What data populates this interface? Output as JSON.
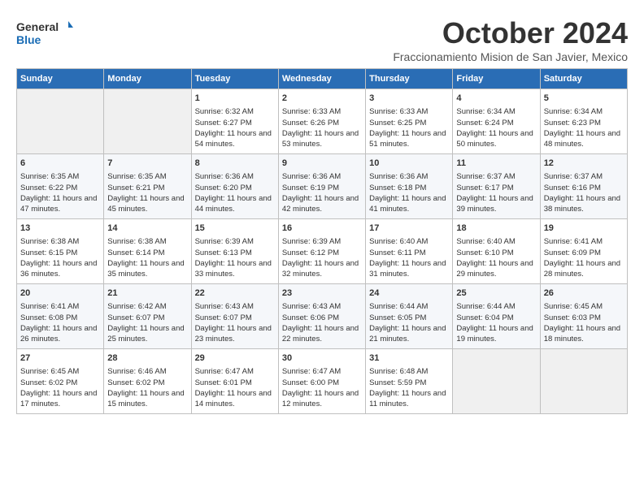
{
  "header": {
    "logo_line1": "General",
    "logo_line2": "Blue",
    "month": "October 2024",
    "location": "Fraccionamiento Mision de San Javier, Mexico"
  },
  "days_of_week": [
    "Sunday",
    "Monday",
    "Tuesday",
    "Wednesday",
    "Thursday",
    "Friday",
    "Saturday"
  ],
  "weeks": [
    [
      {
        "day": "",
        "info": ""
      },
      {
        "day": "",
        "info": ""
      },
      {
        "day": "1",
        "info": "Sunrise: 6:32 AM\nSunset: 6:27 PM\nDaylight: 11 hours and 54 minutes."
      },
      {
        "day": "2",
        "info": "Sunrise: 6:33 AM\nSunset: 6:26 PM\nDaylight: 11 hours and 53 minutes."
      },
      {
        "day": "3",
        "info": "Sunrise: 6:33 AM\nSunset: 6:25 PM\nDaylight: 11 hours and 51 minutes."
      },
      {
        "day": "4",
        "info": "Sunrise: 6:34 AM\nSunset: 6:24 PM\nDaylight: 11 hours and 50 minutes."
      },
      {
        "day": "5",
        "info": "Sunrise: 6:34 AM\nSunset: 6:23 PM\nDaylight: 11 hours and 48 minutes."
      }
    ],
    [
      {
        "day": "6",
        "info": "Sunrise: 6:35 AM\nSunset: 6:22 PM\nDaylight: 11 hours and 47 minutes."
      },
      {
        "day": "7",
        "info": "Sunrise: 6:35 AM\nSunset: 6:21 PM\nDaylight: 11 hours and 45 minutes."
      },
      {
        "day": "8",
        "info": "Sunrise: 6:36 AM\nSunset: 6:20 PM\nDaylight: 11 hours and 44 minutes."
      },
      {
        "day": "9",
        "info": "Sunrise: 6:36 AM\nSunset: 6:19 PM\nDaylight: 11 hours and 42 minutes."
      },
      {
        "day": "10",
        "info": "Sunrise: 6:36 AM\nSunset: 6:18 PM\nDaylight: 11 hours and 41 minutes."
      },
      {
        "day": "11",
        "info": "Sunrise: 6:37 AM\nSunset: 6:17 PM\nDaylight: 11 hours and 39 minutes."
      },
      {
        "day": "12",
        "info": "Sunrise: 6:37 AM\nSunset: 6:16 PM\nDaylight: 11 hours and 38 minutes."
      }
    ],
    [
      {
        "day": "13",
        "info": "Sunrise: 6:38 AM\nSunset: 6:15 PM\nDaylight: 11 hours and 36 minutes."
      },
      {
        "day": "14",
        "info": "Sunrise: 6:38 AM\nSunset: 6:14 PM\nDaylight: 11 hours and 35 minutes."
      },
      {
        "day": "15",
        "info": "Sunrise: 6:39 AM\nSunset: 6:13 PM\nDaylight: 11 hours and 33 minutes."
      },
      {
        "day": "16",
        "info": "Sunrise: 6:39 AM\nSunset: 6:12 PM\nDaylight: 11 hours and 32 minutes."
      },
      {
        "day": "17",
        "info": "Sunrise: 6:40 AM\nSunset: 6:11 PM\nDaylight: 11 hours and 31 minutes."
      },
      {
        "day": "18",
        "info": "Sunrise: 6:40 AM\nSunset: 6:10 PM\nDaylight: 11 hours and 29 minutes."
      },
      {
        "day": "19",
        "info": "Sunrise: 6:41 AM\nSunset: 6:09 PM\nDaylight: 11 hours and 28 minutes."
      }
    ],
    [
      {
        "day": "20",
        "info": "Sunrise: 6:41 AM\nSunset: 6:08 PM\nDaylight: 11 hours and 26 minutes."
      },
      {
        "day": "21",
        "info": "Sunrise: 6:42 AM\nSunset: 6:07 PM\nDaylight: 11 hours and 25 minutes."
      },
      {
        "day": "22",
        "info": "Sunrise: 6:43 AM\nSunset: 6:07 PM\nDaylight: 11 hours and 23 minutes."
      },
      {
        "day": "23",
        "info": "Sunrise: 6:43 AM\nSunset: 6:06 PM\nDaylight: 11 hours and 22 minutes."
      },
      {
        "day": "24",
        "info": "Sunrise: 6:44 AM\nSunset: 6:05 PM\nDaylight: 11 hours and 21 minutes."
      },
      {
        "day": "25",
        "info": "Sunrise: 6:44 AM\nSunset: 6:04 PM\nDaylight: 11 hours and 19 minutes."
      },
      {
        "day": "26",
        "info": "Sunrise: 6:45 AM\nSunset: 6:03 PM\nDaylight: 11 hours and 18 minutes."
      }
    ],
    [
      {
        "day": "27",
        "info": "Sunrise: 6:45 AM\nSunset: 6:02 PM\nDaylight: 11 hours and 17 minutes."
      },
      {
        "day": "28",
        "info": "Sunrise: 6:46 AM\nSunset: 6:02 PM\nDaylight: 11 hours and 15 minutes."
      },
      {
        "day": "29",
        "info": "Sunrise: 6:47 AM\nSunset: 6:01 PM\nDaylight: 11 hours and 14 minutes."
      },
      {
        "day": "30",
        "info": "Sunrise: 6:47 AM\nSunset: 6:00 PM\nDaylight: 11 hours and 12 minutes."
      },
      {
        "day": "31",
        "info": "Sunrise: 6:48 AM\nSunset: 5:59 PM\nDaylight: 11 hours and 11 minutes."
      },
      {
        "day": "",
        "info": ""
      },
      {
        "day": "",
        "info": ""
      }
    ]
  ]
}
